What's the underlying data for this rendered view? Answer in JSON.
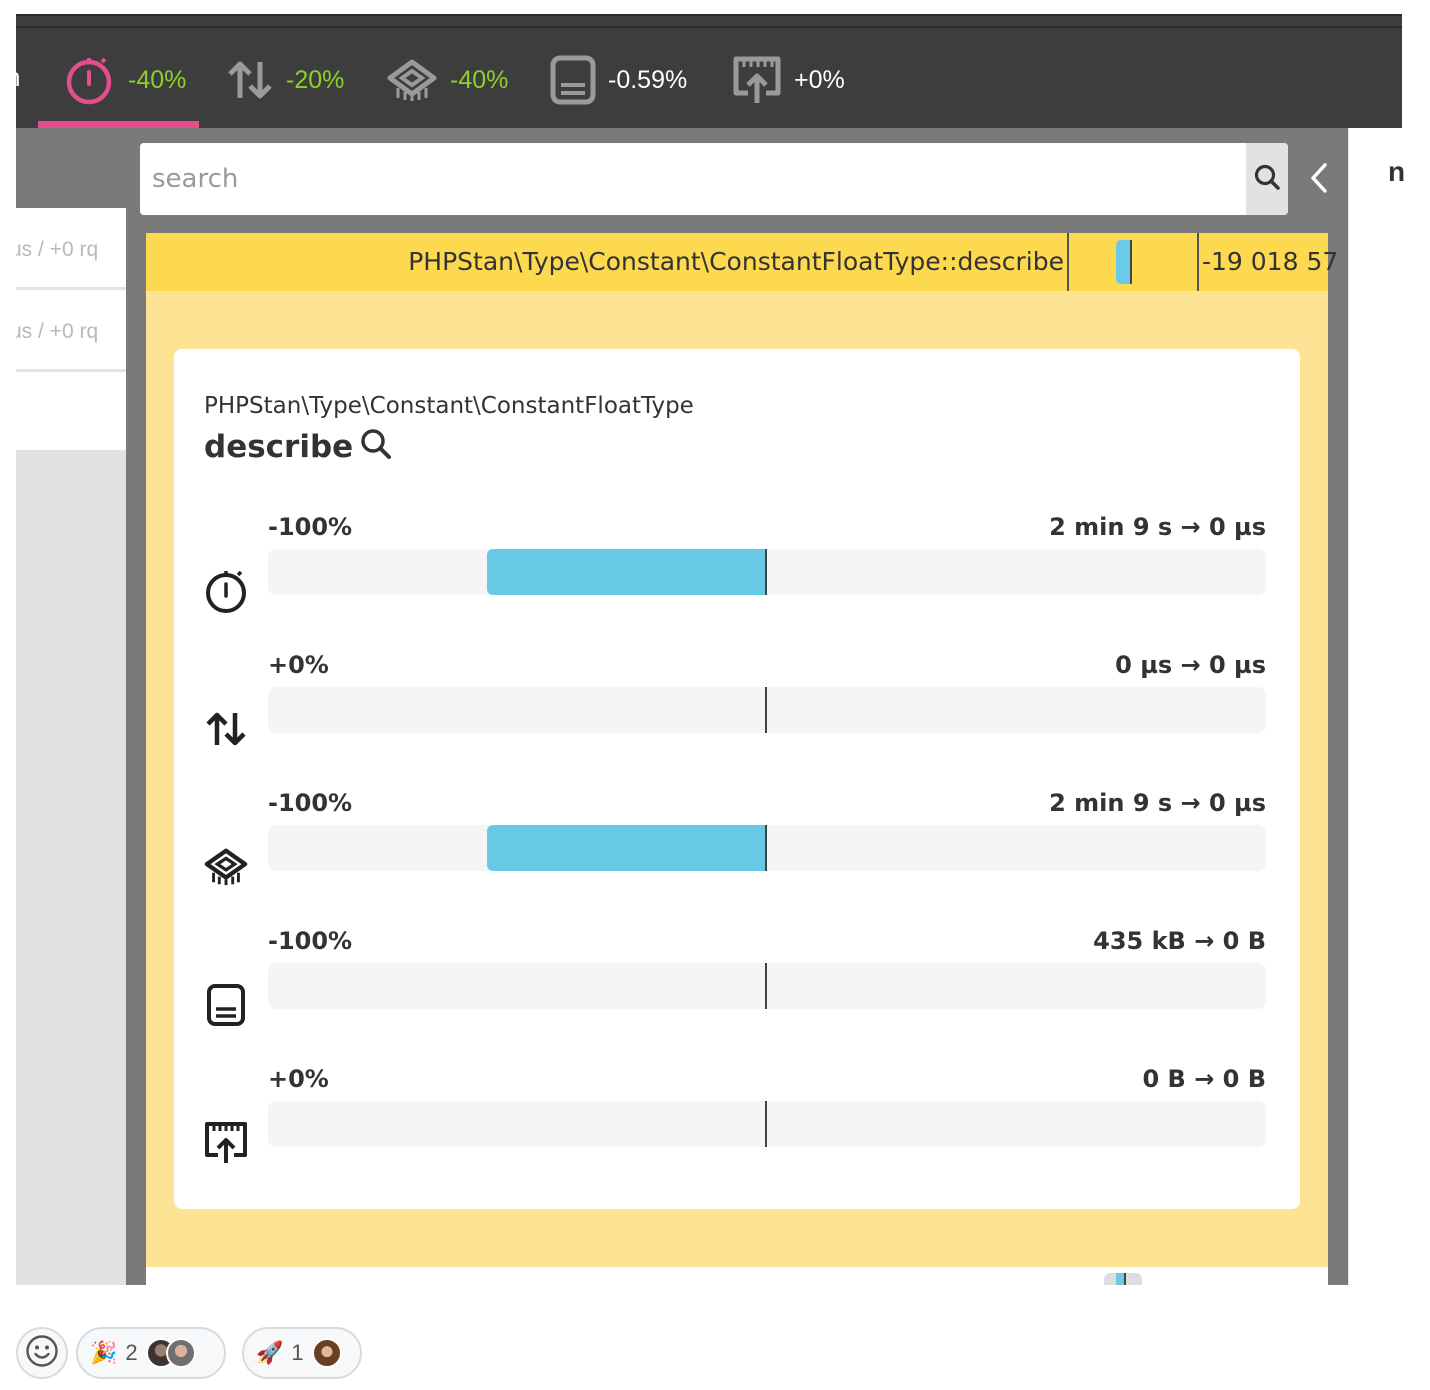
{
  "topbar": {
    "cut_letter": "n",
    "metrics": [
      {
        "icon": "stopwatch-icon",
        "value": "-40%",
        "color": "#8cd12a",
        "active": true
      },
      {
        "icon": "io-arrows-icon",
        "value": "-20%",
        "color": "#8cd12a"
      },
      {
        "icon": "cpu-icon",
        "value": "-40%",
        "color": "#8cd12a"
      },
      {
        "icon": "memory-icon",
        "value": "-0.59%",
        "color": "#ffffff"
      },
      {
        "icon": "network-icon",
        "value": "+0%",
        "color": "#ffffff"
      }
    ],
    "active_color": "#e44e8d"
  },
  "left_panel": {
    "rows": [
      "us / +0 rq",
      "us / +0 rq"
    ]
  },
  "right_strip": {
    "cut_letter": "n"
  },
  "search": {
    "placeholder": "search"
  },
  "function_row": {
    "name": "PHPStan\\Type\\Constant\\ConstantFloatType::describe",
    "value": "-19 018 57"
  },
  "detail": {
    "class_name": "PHPStan\\Type\\Constant\\ConstantFloatType",
    "method_name": "describe",
    "metrics": [
      {
        "icon": "stopwatch-icon",
        "percent": "-100%",
        "change": "2 min 9 s → 0 µs",
        "fill_fraction": -0.28
      },
      {
        "icon": "io-arrows-icon",
        "percent": "+0%",
        "change": "0 µs → 0 µs",
        "fill_fraction": 0
      },
      {
        "icon": "cpu-icon",
        "percent": "-100%",
        "change": "2 min 9 s → 0 µs",
        "fill_fraction": -0.28
      },
      {
        "icon": "memory-icon",
        "percent": "-100%",
        "change": "435 kB → 0 B",
        "fill_fraction": 0
      },
      {
        "icon": "network-icon",
        "percent": "+0%",
        "change": "0 B → 0 B",
        "fill_fraction": 0
      }
    ],
    "bar_color": "#66cae6"
  },
  "reactions": [
    {
      "icon": "smiley-icon"
    },
    {
      "icon": "party-popper-icon",
      "emoji": "🎉",
      "count": "2"
    },
    {
      "icon": "rocket-icon",
      "emoji": "🚀",
      "count": "1"
    }
  ]
}
